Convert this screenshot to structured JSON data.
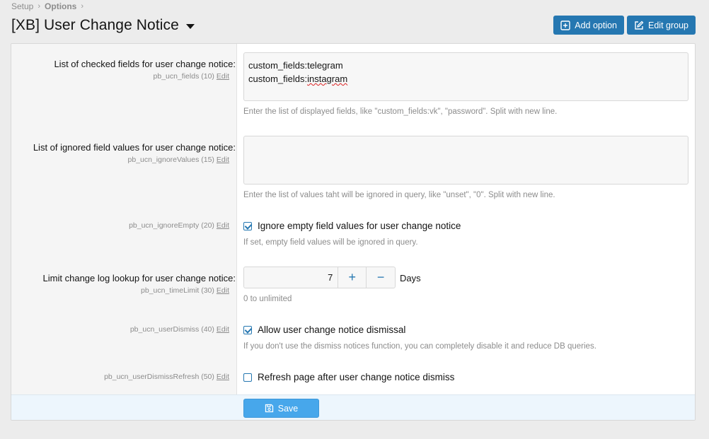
{
  "breadcrumb": {
    "items": [
      "Setup",
      "Options"
    ]
  },
  "header": {
    "title": "[XB] User Change Notice",
    "add_option_label": "Add option",
    "edit_group_label": "Edit group"
  },
  "options": [
    {
      "label": "List of checked fields for user change notice:",
      "meta": "pb_ucn_fields (10)",
      "edit": "Edit",
      "value_lines": [
        "custom_fields:telegram",
        "custom_fields:",
        "instagram"
      ],
      "hint": "Enter the list of displayed fields, like \"custom_fields:vk\", \"password\". Split with new line."
    },
    {
      "label": "List of ignored field values for user change notice:",
      "meta": "pb_ucn_ignoreValues (15)",
      "edit": "Edit",
      "value": "",
      "hint": "Enter the list of values taht will be ignored in query, like \"unset\", \"0\". Split with new line."
    },
    {
      "meta": "pb_ucn_ignoreEmpty (20)",
      "edit": "Edit",
      "checkbox_label": "Ignore empty field values for user change notice",
      "checked": true,
      "hint": "If set, empty field values will be ignored in query."
    },
    {
      "label": "Limit change log lookup for user change notice:",
      "meta": "pb_ucn_timeLimit (30)",
      "edit": "Edit",
      "value": "7",
      "plus": "+",
      "minus": "−",
      "unit": "Days",
      "hint": "0 to unlimited"
    },
    {
      "meta": "pb_ucn_userDismiss (40)",
      "edit": "Edit",
      "checkbox_label": "Allow user change notice dismissal",
      "checked": true,
      "hint": "If you don't use the dismiss notices function, you can completely disable it and reduce DB queries."
    },
    {
      "meta": "pb_ucn_userDismissRefresh (50)",
      "edit": "Edit",
      "checkbox_label": "Refresh page after user change notice dismiss",
      "checked": false
    }
  ],
  "footer": {
    "save_label": "Save"
  },
  "colors": {
    "accent": "#2577b1",
    "save": "#47a7eb",
    "footer_bg": "#edf6fd"
  }
}
